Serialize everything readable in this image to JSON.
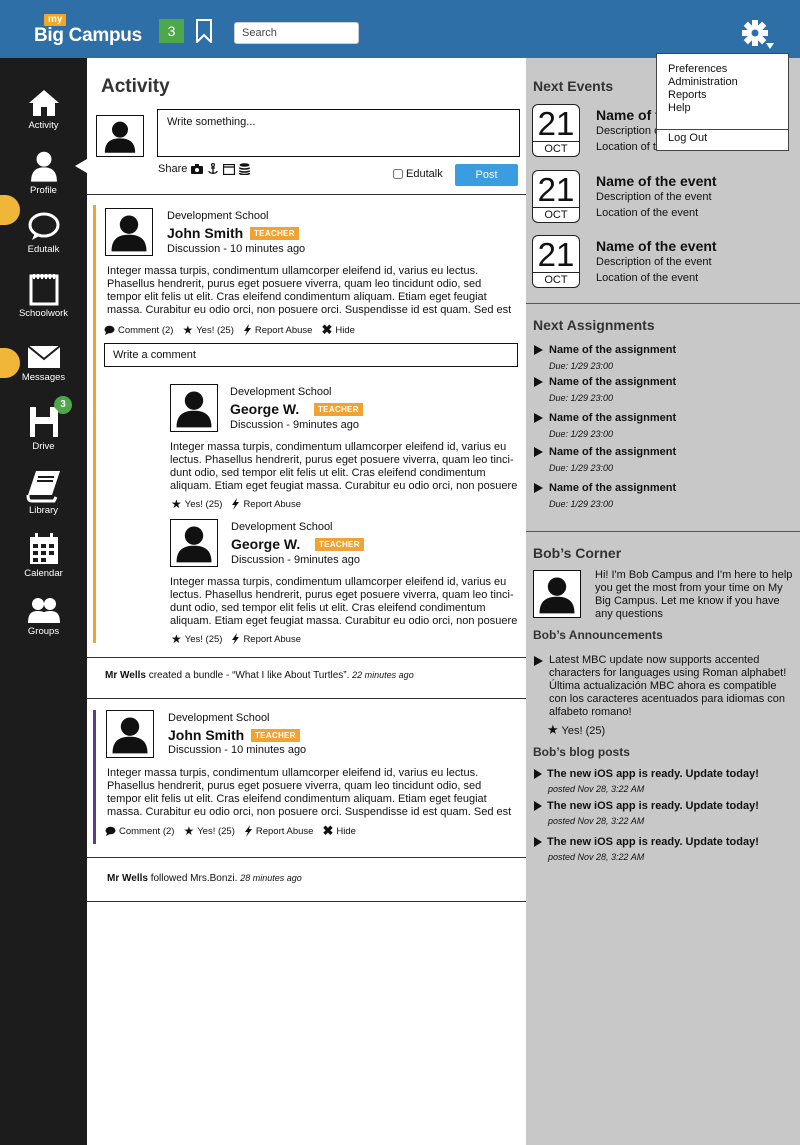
{
  "header": {
    "logo_my": "my",
    "logo_name": "Big Campus",
    "notification_count": "3",
    "search_placeholder": "Search"
  },
  "settings_menu": {
    "items": [
      "Preferences",
      "Administration",
      "Reports",
      "Help"
    ],
    "logout": "Log Out"
  },
  "sidebar": {
    "items": [
      {
        "label": "Activity",
        "icon": "home-icon"
      },
      {
        "label": "Profile",
        "icon": "person-icon"
      },
      {
        "label": "Edutalk",
        "icon": "speech-bubble-icon"
      },
      {
        "label": "Schoolwork",
        "icon": "notepad-icon"
      },
      {
        "label": "Messages",
        "icon": "envelope-icon"
      },
      {
        "label": "Drive",
        "icon": "floppy-disk-icon"
      },
      {
        "label": "Library",
        "icon": "book-icon"
      },
      {
        "label": "Calendar",
        "icon": "calendar-icon"
      },
      {
        "label": "Groups",
        "icon": "group-icon"
      }
    ],
    "messages_badge": "3"
  },
  "composer": {
    "title": "Activity",
    "placeholder": "Write something...",
    "share_label": "Share",
    "edutalk_label": "Edutalk",
    "post_label": "Post"
  },
  "posts": [
    {
      "school": "Development School",
      "author": "John Smith",
      "badge": "TEACHER",
      "meta": "Discussion - 10 minutes ago",
      "body": "Integer massa turpis, condimentum ullamcorper eleifend id, varius eu lectus.\nPhasellus hendrerit, purus eget posuere viverra, quam leo tincidunt odio, sed\ntempor elit felis ut elit. Cras eleifend condimentum aliquam. Etiam eget feugiat\nmassa. Curabitur eu odio orci, non posuere orci. Suspendisse id est quam. Sed est",
      "comment_label": "Comment (2)",
      "yes_label": "Yes! (25)",
      "report_label": "Report Abuse",
      "hide_label": "Hide",
      "write_comment_placeholder": "Write a comment",
      "accent_color": "#f2a230"
    },
    {
      "school": "Development School",
      "author": "John Smith",
      "badge": "TEACHER",
      "meta": "Discussion - 10 minutes ago",
      "body": "Integer massa turpis, condimentum ullamcorper eleifend id, varius eu lectus.\nPhasellus hendrerit, purus eget posuere viverra, quam leo tincidunt odio, sed\ntempor elit felis ut elit. Cras eleifend condimentum aliquam. Etiam eget feugiat\nmassa. Curabitur eu odio orci, non posuere orci. Suspendisse id est quam. Sed est",
      "comment_label": "Comment (2)",
      "yes_label": "Yes! (25)",
      "report_label": "Report Abuse",
      "hide_label": "Hide",
      "accent_color": "#5b3d8a"
    }
  ],
  "replies": [
    {
      "school": "Development School",
      "author": "George W.",
      "badge": "TEACHER",
      "meta": "Discussion - 9minutes ago",
      "body": "Integer massa turpis, condimentum ullamcorper eleifend id, varius eu\nlectus. Phasellus hendrerit, purus eget posuere viverra, quam leo tinci-\ndunt odio, sed tempor elit felis ut elit. Cras eleifend condimentum\naliquam. Etiam eget feugiat massa. Curabitur eu odio orci, non posuere",
      "yes_label": "Yes! (25)",
      "report_label": "Report Abuse"
    },
    {
      "school": "Development School",
      "author": "George W.",
      "badge": "TEACHER",
      "meta": "Discussion - 9minutes ago",
      "body": "Integer massa turpis, condimentum ullamcorper eleifend id, varius eu\nlectus. Phasellus hendrerit, purus eget posuere viverra, quam leo tinci-\ndunt odio, sed tempor elit felis ut elit. Cras eleifend condimentum\naliquam. Etiam eget feugiat massa. Curabitur eu odio orci, non posuere",
      "yes_label": "Yes! (25)",
      "report_label": "Report Abuse"
    }
  ],
  "feed_events": [
    {
      "actor": "Mr Wells",
      "text": " created a bundle - “What I like About Turtles”. ",
      "time": "22 minutes ago"
    },
    {
      "actor": "Mr Wells",
      "text": " followed Mrs.Bonzi. ",
      "time": "28 minutes ago"
    }
  ],
  "next_events": {
    "title": "Next Events",
    "events": [
      {
        "day": "21",
        "month": "OCT",
        "name": "Name of the event",
        "description": "Description of the event",
        "location": "Location of the event"
      },
      {
        "day": "21",
        "month": "OCT",
        "name": "Name of the event",
        "description": "Description of the event",
        "location": "Location of the event"
      },
      {
        "day": "21",
        "month": "OCT",
        "name": "Name of the event",
        "description": "Description of the event",
        "location": "Location of the event"
      }
    ]
  },
  "next_assignments": {
    "title": "Next Assignments",
    "items": [
      {
        "name": "Name of the assignment",
        "due": "Due: 1/29 23:00"
      },
      {
        "name": "Name of the assignment",
        "due": "Due: 1/29 23:00"
      },
      {
        "name": "Name of the assignment",
        "due": "Due: 1/29 23:00"
      },
      {
        "name": "Name of the assignment",
        "due": "Due: 1/29 23:00"
      },
      {
        "name": "Name of the assignment",
        "due": "Due: 1/29 23:00"
      }
    ]
  },
  "bobs_corner": {
    "title": "Bob’s Corner",
    "intro": "Hi! I'm Bob Campus and I'm here to help you get the most from your time on My Big Campus. Let me know if you have any questions",
    "announcements_title": "Bob’s Announcements",
    "announcement": "Latest MBC update now supports accented characters for languages using Roman alphabet! Última actualización MBC ahora es compatible con los caracteres acentuados para idiomas con alfabeto romano!",
    "announcement_yes": "Yes! (25)",
    "blog_title": "Bob’s blog posts",
    "blog_posts": [
      {
        "title": "The new iOS app is ready. Update today!",
        "date": "posted Nov 28, 3:22 AM"
      },
      {
        "title": "The new iOS app is ready. Update today!",
        "date": "posted Nov 28, 3:22 AM"
      },
      {
        "title": "The new iOS app is ready. Update today!",
        "date": "posted Nov 28, 3:22 AM"
      }
    ]
  },
  "colors": {
    "header_blue": "#2e6fa8",
    "sidebar_black": "#1c1c1c",
    "teacher_orange": "#f2a230",
    "post_blue": "#3a9de0",
    "badge_green": "#4ea84b",
    "right_panel_gray": "#c8c8c8"
  }
}
